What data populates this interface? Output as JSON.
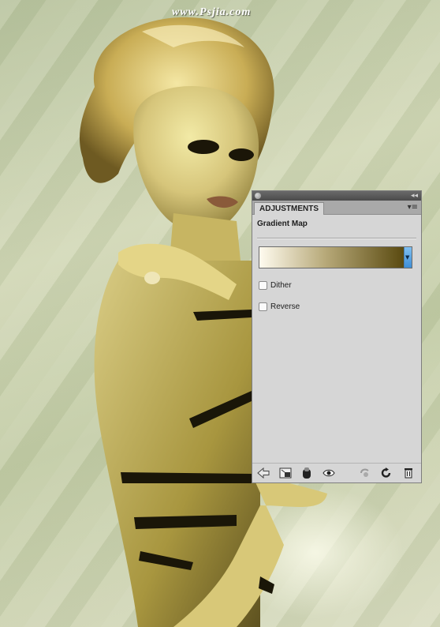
{
  "watermark": "www.Psjia.com",
  "panel": {
    "tab_label": "ADJUSTMENTS",
    "heading": "Gradient Map",
    "gradient": {
      "start_color": "#fffbef",
      "end_color": "#5a4a10"
    },
    "options": [
      {
        "label": "Dither",
        "checked": false
      },
      {
        "label": "Reverse",
        "checked": false
      }
    ],
    "toolbar_icons": [
      "back-arrow-icon",
      "expand-view-icon",
      "clip-to-layer-icon",
      "visibility-eye-icon",
      "view-previous-state-icon",
      "reset-icon",
      "trash-icon"
    ]
  },
  "colors": {
    "panel_bg": "#d6d6d6",
    "tab_bar": "#a9a9a9",
    "photo_tone": "#c8c48a"
  }
}
